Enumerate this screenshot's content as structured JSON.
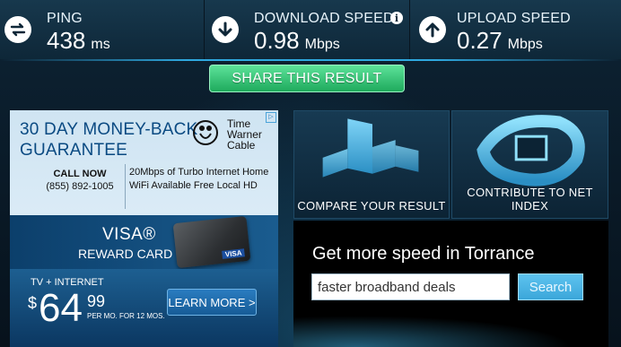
{
  "stats": {
    "ping": {
      "label": "PING",
      "value": "438",
      "unit": "ms",
      "icon": "ping-arrows-icon"
    },
    "download": {
      "label": "DOWNLOAD SPEED",
      "value": "0.98",
      "unit": "Mbps",
      "icon": "download-arrow-icon",
      "info": "i"
    },
    "upload": {
      "label": "UPLOAD SPEED",
      "value": "0.27",
      "unit": "Mbps",
      "icon": "upload-arrow-icon"
    }
  },
  "share": {
    "label": "SHARE THIS RESULT"
  },
  "ad": {
    "headline": "30 DAY MONEY-BACK GUARANTEE",
    "brand": "Time Warner Cable",
    "call_label": "CALL NOW",
    "phone": "(855) 892-1005",
    "offer": "20Mbps of Turbo Internet Home WiFi Available Free Local HD",
    "visa_name": "VISA®",
    "visa_sub": "REWARD CARD",
    "tv_internet": "TV + INTERNET",
    "dollar": "$",
    "price": "64",
    "cents": "99",
    "per_mo": "PER MO. FOR 12 MOS.",
    "learn_more": "LEARN MORE >"
  },
  "tiles": {
    "compare": {
      "label": "COMPARE YOUR RESULT"
    },
    "contribute": {
      "label": "CONTRIBUTE TO NET INDEX"
    }
  },
  "search": {
    "title": "Get more speed in Torrance",
    "input_value": "faster broadband deals",
    "button": "Search"
  },
  "colors": {
    "accent_green": "#2ec46f",
    "accent_blue": "#3ba7da",
    "bar_bg": "#17384d"
  }
}
